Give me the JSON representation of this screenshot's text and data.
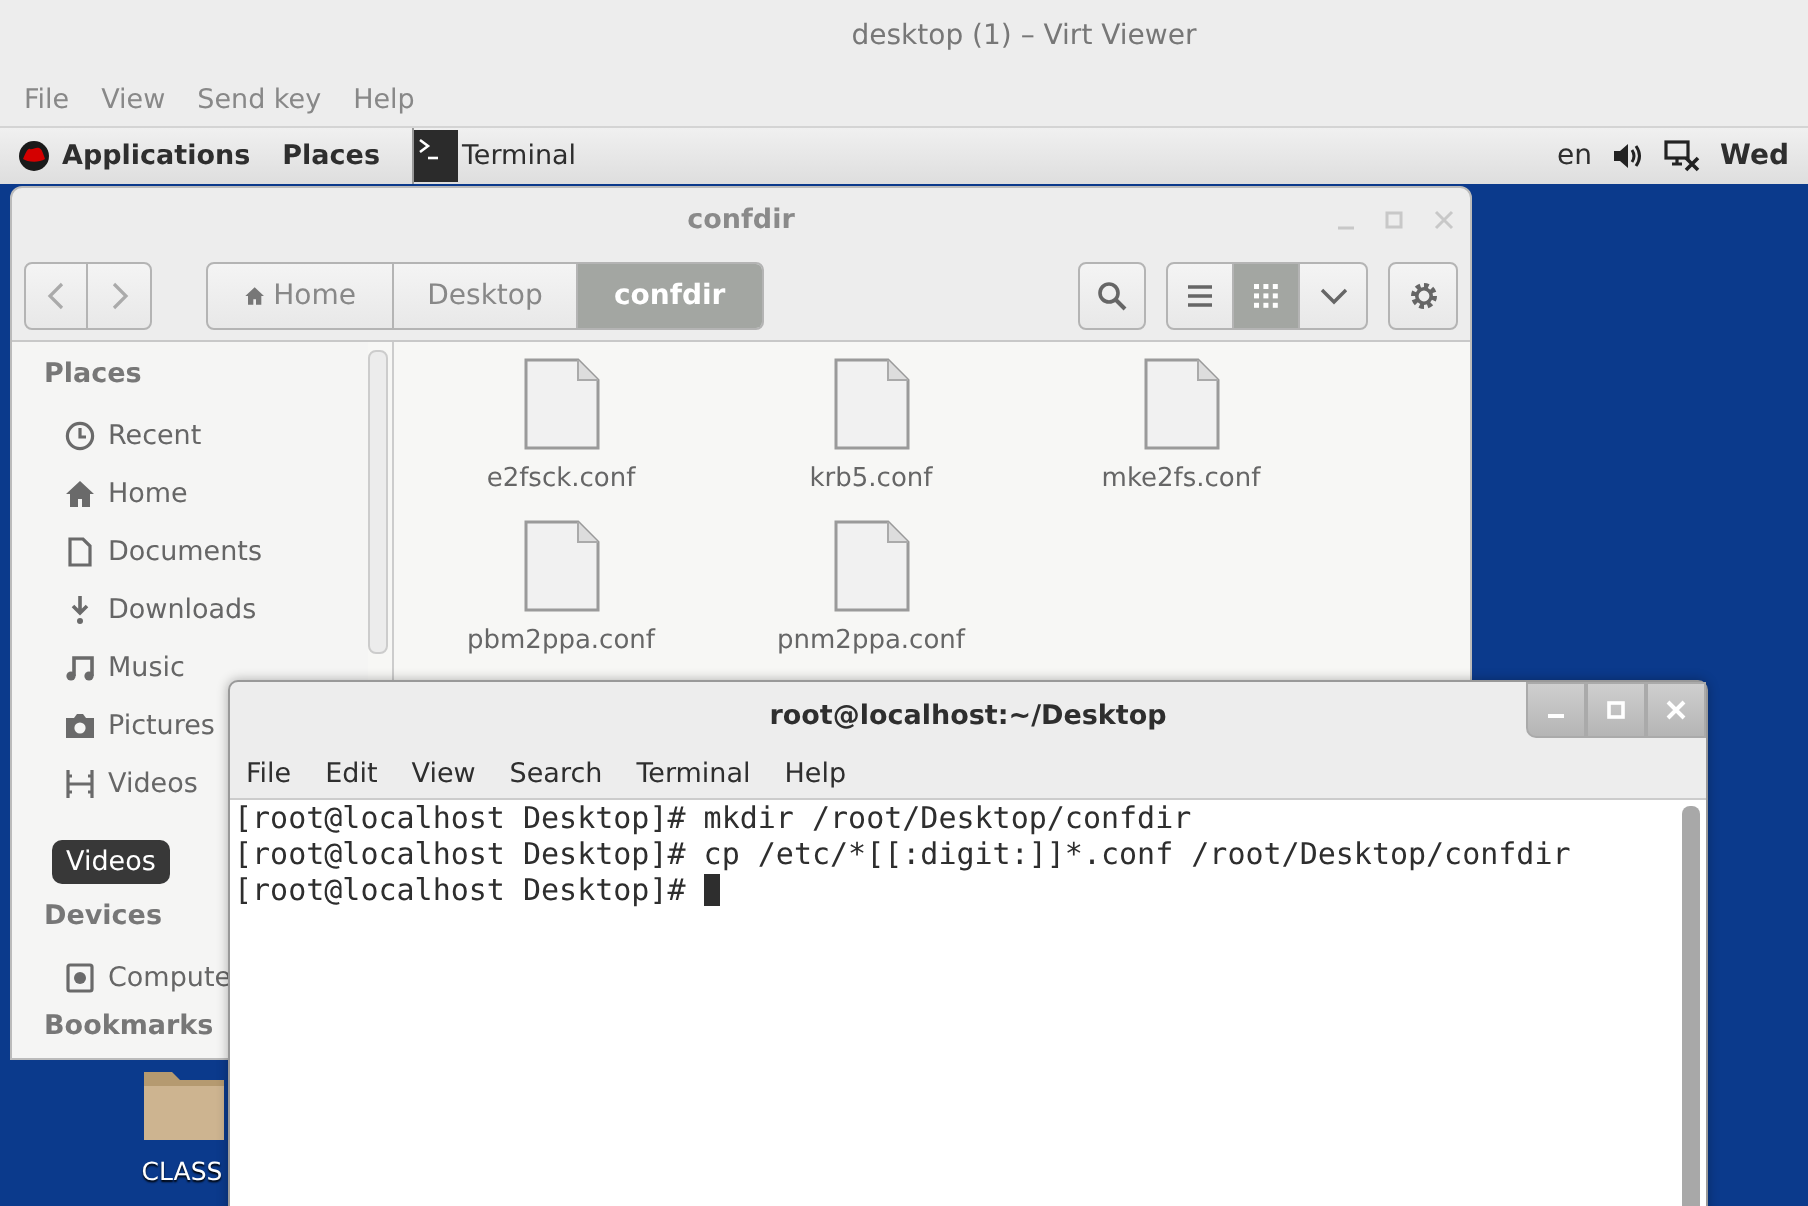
{
  "viewer": {
    "title": "desktop (1) – Virt Viewer",
    "menu": [
      "File",
      "View",
      "Send key",
      "Help"
    ]
  },
  "top_bar": {
    "menus": [
      {
        "label": "Applications",
        "kind": "apps"
      },
      {
        "label": "Places",
        "kind": "plain"
      }
    ],
    "task": {
      "label": "Terminal"
    },
    "keyboard": "en",
    "clock": "Wed"
  },
  "files": {
    "title": "confdir",
    "path": [
      {
        "label": "Home",
        "kind": "home",
        "selected": false
      },
      {
        "label": "Desktop",
        "kind": "plain",
        "selected": false
      },
      {
        "label": "confdir",
        "kind": "plain",
        "selected": true
      }
    ],
    "views": [
      {
        "kind": "list",
        "selected": false
      },
      {
        "kind": "grid",
        "selected": true
      }
    ],
    "sidebar": [
      {
        "heading": "Places",
        "items": [
          {
            "label": "Recent",
            "kind": "clock"
          },
          {
            "label": "Home",
            "kind": "home"
          },
          {
            "label": "Documents",
            "kind": "document"
          },
          {
            "label": "Downloads",
            "kind": "download"
          },
          {
            "label": "Music",
            "kind": "music"
          },
          {
            "label": "Pictures",
            "kind": "camera"
          },
          {
            "label": "Videos",
            "kind": "film"
          }
        ]
      },
      {
        "heading": "Devices",
        "items": [
          {
            "label": "Compute",
            "kind": "computer"
          }
        ]
      },
      {
        "heading": "Bookmarks"
      }
    ],
    "tooltip": "Videos",
    "items": [
      {
        "name": "e2fsck.conf"
      },
      {
        "name": "krb5.conf"
      },
      {
        "name": "mke2fs.conf"
      },
      {
        "name": "pbm2ppa.conf"
      },
      {
        "name": "pnm2ppa.conf"
      }
    ]
  },
  "desktop_icons": [
    {
      "label": "CLASS"
    }
  ],
  "terminal": {
    "title": "root@localhost:~/Desktop",
    "menu": [
      "File",
      "Edit",
      "View",
      "Search",
      "Terminal",
      "Help"
    ],
    "lines": [
      "[root@localhost Desktop]# mkdir /root/Desktop/confdir",
      "[root@localhost Desktop]# cp /etc/*[[:digit:]]*.conf /root/Desktop/confdir",
      "[root@localhost Desktop]# "
    ]
  }
}
